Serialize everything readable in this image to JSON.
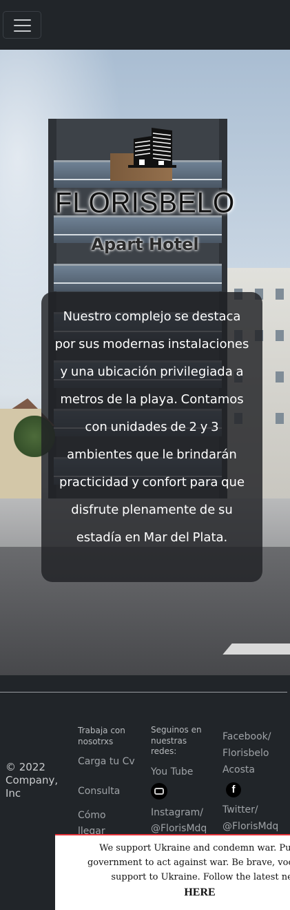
{
  "navbar": {
    "toggle_icon": "hamburger-menu-icon"
  },
  "hero": {
    "logo_icon": "building-logo-icon",
    "brand_name": "FLORISBELO",
    "brand_subtitle": "Apart Hotel",
    "description": "Nuestro complejo se destaca por sus modernas instalaciones y una ubicación privilegiada a metros de la playa. Contamos con unidades de 2 y 3 ambientes que le brindarán practicidad y confort para que disfrute plenamente de su estadía en Mar del Plata."
  },
  "footer": {
    "copyright": "© 2022 Company, Inc",
    "col1": {
      "heading": "Trabaja con nosotrxs",
      "links": [
        "Carga tu Cv",
        "Consulta",
        "Cómo llegar"
      ]
    },
    "col2": {
      "heading": "Seguinos en nuestras redes:",
      "youtube_label": "You Tube",
      "youtube_icon": "youtube-icon",
      "instagram_label": "Instagram/ @FlorisMdq"
    },
    "col3": {
      "facebook_label": "Facebook/ Florisbelo Acosta",
      "facebook_icon": "facebook-icon",
      "twitter_label": "Twitter/ @FlorisMdq"
    }
  },
  "banner": {
    "line1": "We support Ukraine and condemn war. Push Ru",
    "line2": "government to act against war. Be brave, vocal and s",
    "line3": "support to Ukraine. Follow the latest news",
    "link": "HERE",
    "accent_color": "#e5333a"
  }
}
